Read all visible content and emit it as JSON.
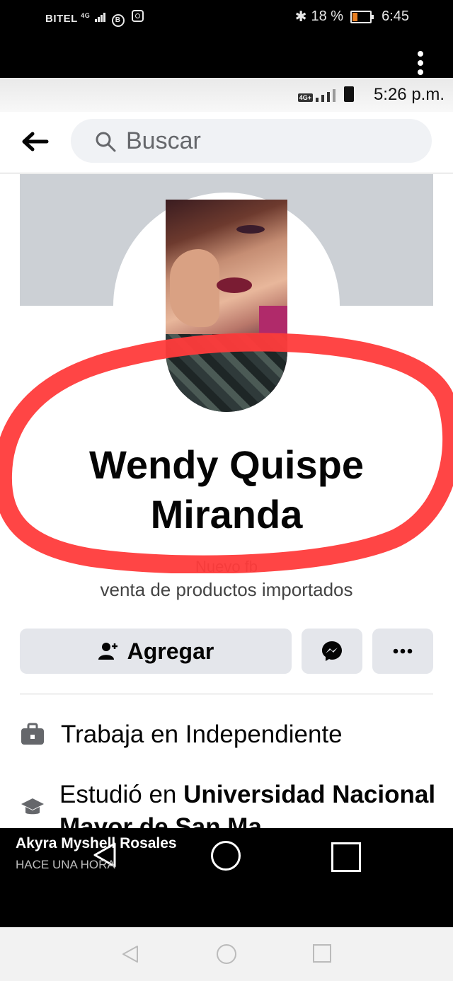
{
  "outer_status": {
    "carrier": "BITEL",
    "network": "4G",
    "battery": "18 %",
    "time": "6:45"
  },
  "inner_status": {
    "network": "4G+",
    "time": "5:26 p.m."
  },
  "search": {
    "placeholder": "Buscar"
  },
  "profile": {
    "name": "Wendy Quispe Miranda",
    "bio_line1": "Nuevo fb",
    "bio_line2": "venta de productos importados"
  },
  "actions": {
    "add_label": "Agregar"
  },
  "info": {
    "work": "Trabaja en Independiente",
    "study_prefix": "Estudió en ",
    "study_place": "Universidad Nacional Mayor de San Ma..."
  },
  "notification": {
    "name": "Akyra Myshell Rosales",
    "time": "HACE UNA HORA"
  },
  "colors": {
    "highlight_ring": "#ff3b3b",
    "button_bg": "#e4e6eb",
    "cover_bg": "#ccd0d5"
  },
  "icons": [
    "back-arrow-icon",
    "search-icon",
    "add-friend-icon",
    "messenger-icon",
    "more-icon",
    "briefcase-icon",
    "graduation-cap-icon"
  ]
}
